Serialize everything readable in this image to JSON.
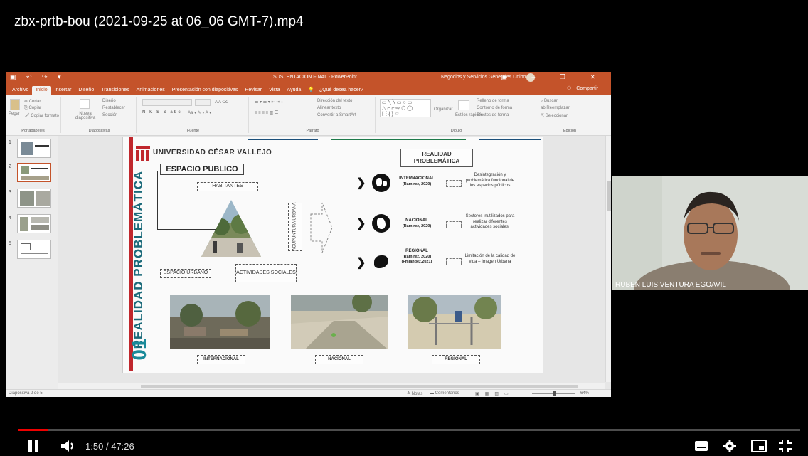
{
  "video": {
    "title": "zbx-prtb-bou (2021-09-25 at 06_06 GMT-7).mp4",
    "time_current": "1:50",
    "time_separator": "/",
    "time_total": "47:26",
    "progress": 0.0387
  },
  "powerpoint": {
    "window_title": "SUSTENTACION FINAL - PowerPoint",
    "account": "Negocios y Servicios Generales Unibo",
    "menu": [
      "Archivo",
      "Inicio",
      "Insertar",
      "Diseño",
      "Transiciones",
      "Animaciones",
      "Presentación con diapositivas",
      "Revisar",
      "Vista",
      "Ayuda",
      "¿Qué desea hacer?"
    ],
    "share_label": "Compartir",
    "ribbon": {
      "clipboard": {
        "paste": "Pegar",
        "cut": "Cortar",
        "copy": "Copiar",
        "format": "Copiar formato",
        "group": "Portapapeles"
      },
      "slides": {
        "new": "Nueva diapositiva",
        "layout": "Diseño",
        "reset": "Restablecer",
        "section": "Sección",
        "group": "Diapositivas"
      },
      "font": {
        "group": "Fuente",
        "bold": "N K S S abc"
      },
      "paragraph": {
        "group": "Párrafo",
        "direction": "Dirección del texto",
        "align": "Alinear texto",
        "smartart": "Convertir a SmartArt"
      },
      "drawing": {
        "group": "Dibujo",
        "arrange": "Organizar",
        "styles": "Estilos rápidos",
        "fill": "Relleno de forma",
        "outline": "Contorno de forma",
        "effects": "Efectos de forma"
      },
      "editing": {
        "group": "Edición",
        "find": "Buscar",
        "replace": "Reemplazar",
        "select": "Seleccionar"
      }
    },
    "thumbnails": [
      "1",
      "2",
      "3",
      "4",
      "5"
    ],
    "status": {
      "slide": "Diapositiva 2 de 5",
      "notes": "Notas",
      "comments": "Comentarios",
      "zoom": "64%"
    }
  },
  "slide": {
    "university": "UNIVERSIDAD CÉSAR VALLEJO",
    "vertical_title": "REALIDAD PROBLEMÁTICA",
    "number": "01",
    "espacio_publico": "ESPACIO PUBLICO",
    "habitantes": "HABITANTES",
    "espacio_urbano": "ESPACIO URBANO",
    "actividades": "ACTIVIDADES SOCIALES",
    "acupuntura": "ACUPUNTURA URBANA",
    "realidad_box": "REALIDAD PROBLEMÁTICA",
    "rows": [
      {
        "label": "INTERNACIONAL",
        "source": "(Ramirez, 2020)",
        "desc": "Desintegración y problemática funcional de los espacios públicos"
      },
      {
        "label": "NACIONAL",
        "source": "(Ramirez, 2020)",
        "desc": "Sectores inutilizados para realizar diferentes actividades sociales."
      },
      {
        "label": "REGIONAL",
        "source": "(Ramirez, 2020) (Fmlández,2021)",
        "desc": "Limitación de la calidad de vida – Imagen Urbana"
      }
    ],
    "photo_labels": [
      "INTERNACIONAL",
      "NACIONAL",
      "REGIONAL"
    ]
  },
  "webcam": {
    "name": "RUBEN LUIS VENTURA EGOAVIL"
  },
  "controls": {
    "pause": "pause-icon",
    "volume": "volume-icon",
    "subtitles": "subtitles-icon",
    "settings": "settings-icon",
    "miniplayer": "miniplayer-icon",
    "exit_fullscreen": "exit-fullscreen-icon"
  }
}
